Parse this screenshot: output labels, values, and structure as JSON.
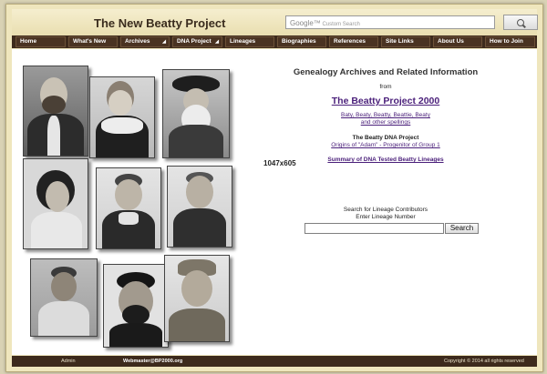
{
  "header": {
    "site_title": "The New Beatty Project",
    "search_placeholder": "Custom Search",
    "search_brand": "Google™"
  },
  "nav": {
    "items": [
      {
        "label": "Home"
      },
      {
        "label": "What's New"
      },
      {
        "label": "Archives"
      },
      {
        "label": "DNA Project"
      },
      {
        "label": "Lineages"
      },
      {
        "label": "Biographies"
      },
      {
        "label": "References"
      },
      {
        "label": "Site Links"
      },
      {
        "label": "About Us"
      },
      {
        "label": "How to Join"
      }
    ],
    "dropdown_glyph": "◢"
  },
  "main": {
    "heading": "Genealogy Archives and Related Information",
    "from": "from",
    "project_link": "The Beatty Project 2000",
    "spellings_line1": "Baty, Beaty, Beatty, Beattie, Beaty",
    "spellings_line2": "and other spellings",
    "dna_title": "The Beatty DNA Project",
    "dna_link": "Origins of \"Adam\" - Progenitor of Group 1",
    "summary_link": "Summary of DNA Tested Beatty Lineages",
    "image_dims": "1047x605",
    "search_label1": "Search for Lineage Contributors",
    "search_label2": "Enter Lineage Number",
    "search_button": "Search"
  },
  "footer": {
    "admin": "Admin",
    "webmaster": "Webmaster@BP2000.org",
    "copyright": "Copyright © 2014 all rights reserved"
  },
  "colors": {
    "nav_bg": "#3d2a1c",
    "nav_item": "#4a3322",
    "page_bg": "#efe6bd",
    "link": "#4a1f7a"
  }
}
